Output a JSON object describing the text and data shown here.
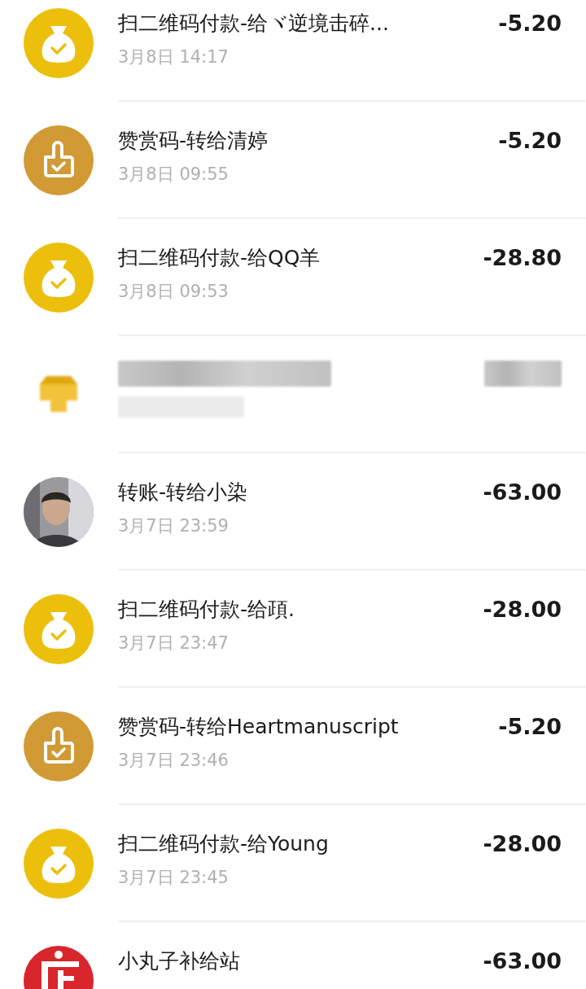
{
  "transactions": [
    {
      "kind": "qrpay",
      "title": "扫二维码付款-给ヾ逆境击碎...",
      "time": "3月8日 14:17",
      "amount": "-5.20"
    },
    {
      "kind": "reward",
      "title": "赞赏码-转给清婷",
      "time": "3月8日 09:55",
      "amount": "-5.20"
    },
    {
      "kind": "qrpay",
      "title": "扫二维码付款-给QQ羊",
      "time": "3月8日 09:53",
      "amount": "-28.80"
    },
    {
      "kind": "redacted"
    },
    {
      "kind": "transfer",
      "title": "转账-转给小染",
      "time": "3月7日 23:59",
      "amount": "-63.00"
    },
    {
      "kind": "qrpay",
      "title": "扫二维码付款-给頙.",
      "time": "3月7日 23:47",
      "amount": "-28.00"
    },
    {
      "kind": "reward",
      "title": "赞赏码-转给Heartmanuscript",
      "time": "3月7日 23:46",
      "amount": "-5.20"
    },
    {
      "kind": "qrpay",
      "title": "扫二维码付款-给Young",
      "time": "3月7日 23:45",
      "amount": "-28.00"
    },
    {
      "kind": "merchant",
      "title": "小丸子补给站",
      "amount": "-63.00"
    }
  ]
}
